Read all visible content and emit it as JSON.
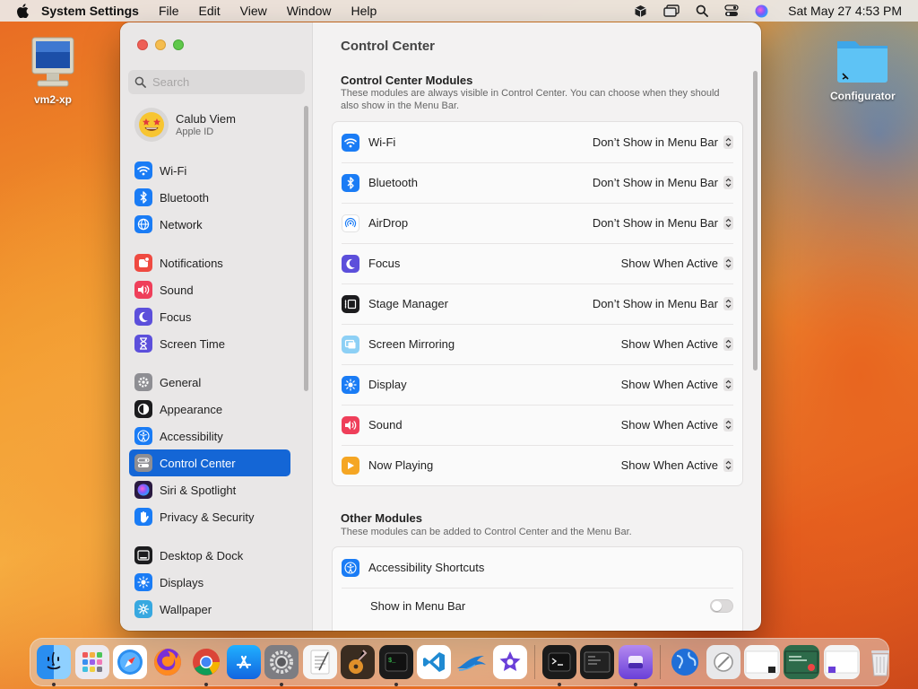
{
  "menubar": {
    "app": "System Settings",
    "items": [
      "File",
      "Edit",
      "View",
      "Window",
      "Help"
    ],
    "clock": "Sat May 27  4:53 PM"
  },
  "desktop": {
    "left_icon": "vm2-xp",
    "right_icon": "Configurator"
  },
  "sidebar": {
    "search_placeholder": "Search",
    "profile": {
      "name": "Calub Viem",
      "subtitle": "Apple ID"
    },
    "groups": [
      [
        {
          "label": "Wi-Fi",
          "icon": "wifi-icon",
          "color": "#1a7cf5"
        },
        {
          "label": "Bluetooth",
          "icon": "bluetooth-icon",
          "color": "#1a7cf5"
        },
        {
          "label": "Network",
          "icon": "network-icon",
          "color": "#1a7cf5"
        }
      ],
      [
        {
          "label": "Notifications",
          "icon": "notifications-icon",
          "color": "#ef4a41"
        },
        {
          "label": "Sound",
          "icon": "sound-icon",
          "color": "#ef3f5a"
        },
        {
          "label": "Focus",
          "icon": "focus-icon",
          "color": "#5c4fdb"
        },
        {
          "label": "Screen Time",
          "icon": "screen-time-icon",
          "color": "#5c4fdb"
        }
      ],
      [
        {
          "label": "General",
          "icon": "general-icon",
          "color": "#8e8e93"
        },
        {
          "label": "Appearance",
          "icon": "appearance-icon",
          "color": "#1c1c1e"
        },
        {
          "label": "Accessibility",
          "icon": "accessibility-icon",
          "color": "#1a7cf5"
        },
        {
          "label": "Control Center",
          "icon": "control-center-icon",
          "color": "#8e8e93",
          "active": true
        },
        {
          "label": "Siri & Spotlight",
          "icon": "siri-icon",
          "color": "#7a3ad8"
        },
        {
          "label": "Privacy & Security",
          "icon": "privacy-hand-icon",
          "color": "#1a7cf5"
        }
      ],
      [
        {
          "label": "Desktop & Dock",
          "icon": "desktop-dock-icon",
          "color": "#1c1c1e"
        },
        {
          "label": "Displays",
          "icon": "displays-icon",
          "color": "#1a7cf5"
        },
        {
          "label": "Wallpaper",
          "icon": "wallpaper-icon",
          "color": "#37a8e0"
        }
      ]
    ]
  },
  "main": {
    "title": "Control Center",
    "modules_title": "Control Center Modules",
    "modules_desc": "These modules are always visible in Control Center. You can choose when they should also show in the Menu Bar.",
    "modules": [
      {
        "label": "Wi-Fi",
        "value": "Don’t Show in Menu Bar",
        "icon": "wifi-icon",
        "color": "#1a7cf5"
      },
      {
        "label": "Bluetooth",
        "value": "Don’t Show in Menu Bar",
        "icon": "bluetooth-icon",
        "color": "#1a7cf5"
      },
      {
        "label": "AirDrop",
        "value": "Don’t Show in Menu Bar",
        "icon": "airdrop-icon",
        "color": "#ffffff"
      },
      {
        "label": "Focus",
        "value": "Show When Active",
        "icon": "focus-icon",
        "color": "#5c4fdb"
      },
      {
        "label": "Stage Manager",
        "value": "Don’t Show in Menu Bar",
        "icon": "stage-manager-icon",
        "color": "#1c1c1e"
      },
      {
        "label": "Screen Mirroring",
        "value": "Show When Active",
        "icon": "screen-mirroring-icon",
        "color": "#8dd0f5"
      },
      {
        "label": "Display",
        "value": "Show When Active",
        "icon": "display-brightness-icon",
        "color": "#1a7cf5"
      },
      {
        "label": "Sound",
        "value": "Show When Active",
        "icon": "sound-icon",
        "color": "#ef3f5a"
      },
      {
        "label": "Now Playing",
        "value": "Show When Active",
        "icon": "now-playing-icon",
        "color": "#f5a623"
      }
    ],
    "other_title": "Other Modules",
    "other_desc": "These modules can be added to Control Center and the Menu Bar.",
    "other": {
      "label": "Accessibility Shortcuts",
      "icon": "accessibility-icon",
      "color": "#1a7cf5",
      "toggle_label": "Show in Menu Bar",
      "toggle_on": false
    }
  },
  "dock": {
    "apps": [
      {
        "name": "finder-icon",
        "running": true
      },
      {
        "name": "launchpad-icon",
        "running": false
      },
      {
        "name": "safari-icon",
        "running": false
      },
      {
        "name": "firefox-icon",
        "running": false
      },
      {
        "name": "chrome-icon",
        "running": true
      },
      {
        "name": "app-store-icon",
        "running": false
      },
      {
        "name": "system-settings-icon",
        "running": true
      },
      {
        "name": "textedit-icon",
        "running": false
      },
      {
        "name": "garageband-icon",
        "running": false
      },
      {
        "name": "terminal-icon",
        "running": true
      },
      {
        "name": "vscode-icon",
        "running": false
      },
      {
        "name": "wireshark-icon",
        "running": false
      },
      {
        "name": "imovie-icon",
        "running": false
      }
    ],
    "recent": [
      {
        "name": "terminal-recent-icon",
        "running": true
      },
      {
        "name": "console-icon",
        "running": false
      },
      {
        "name": "mosaic-icon",
        "running": true
      }
    ],
    "extras": [
      {
        "name": "network-globe-icon",
        "running": false
      },
      {
        "name": "cleaner-icon",
        "running": false
      },
      {
        "name": "window-thumbnail-icon",
        "running": false
      },
      {
        "name": "window-thumbnail-icon-2",
        "running": false
      },
      {
        "name": "window-thumbnail-icon-3",
        "running": false
      },
      {
        "name": "trash-icon",
        "running": false
      }
    ]
  }
}
